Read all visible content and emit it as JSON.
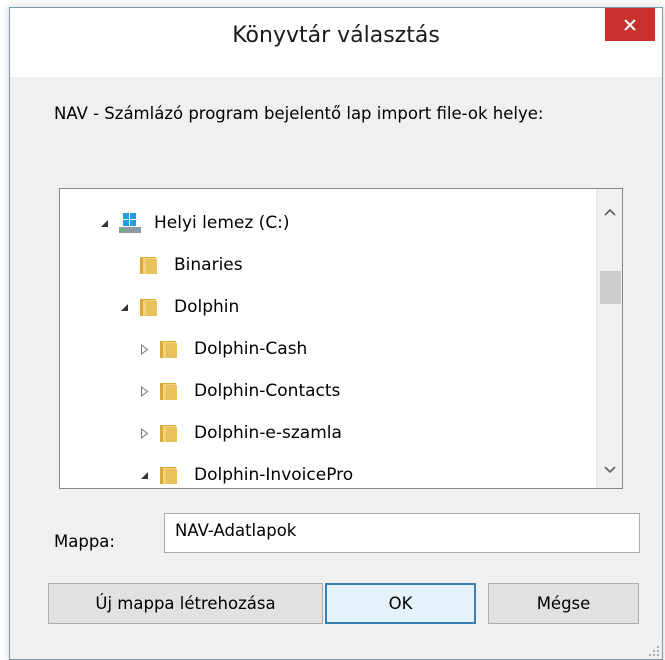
{
  "dialog": {
    "title": "Könyvtár választás",
    "close_glyph": "✕",
    "prompt": "NAV - Számlázó program bejelentő lap import file-ok helye:"
  },
  "tree": {
    "items": [
      {
        "label": "Helyi lemez (C:)",
        "icon": "drive-icon",
        "expander": "expanded"
      },
      {
        "label": "Binaries",
        "icon": "folder-icon",
        "expander": "none"
      },
      {
        "label": "Dolphin",
        "icon": "folder-icon",
        "expander": "expanded"
      },
      {
        "label": "Dolphin-Cash",
        "icon": "folder-icon",
        "expander": "collapsed"
      },
      {
        "label": "Dolphin-Contacts",
        "icon": "folder-icon",
        "expander": "collapsed"
      },
      {
        "label": "Dolphin-e-szamla",
        "icon": "folder-icon",
        "expander": "collapsed"
      },
      {
        "label": "Dolphin-InvoicePro",
        "icon": "folder-icon",
        "expander": "expanded"
      }
    ]
  },
  "folder_field": {
    "label": "Mappa:",
    "value": "NAV-Adatlapok"
  },
  "buttons": {
    "new_folder": "Új mappa létrehozása",
    "ok": "OK",
    "cancel": "Mégse"
  },
  "colors": {
    "close_button": "#c7302b",
    "default_button_border": "#3c7fb1",
    "folder": "#e8c15a"
  }
}
